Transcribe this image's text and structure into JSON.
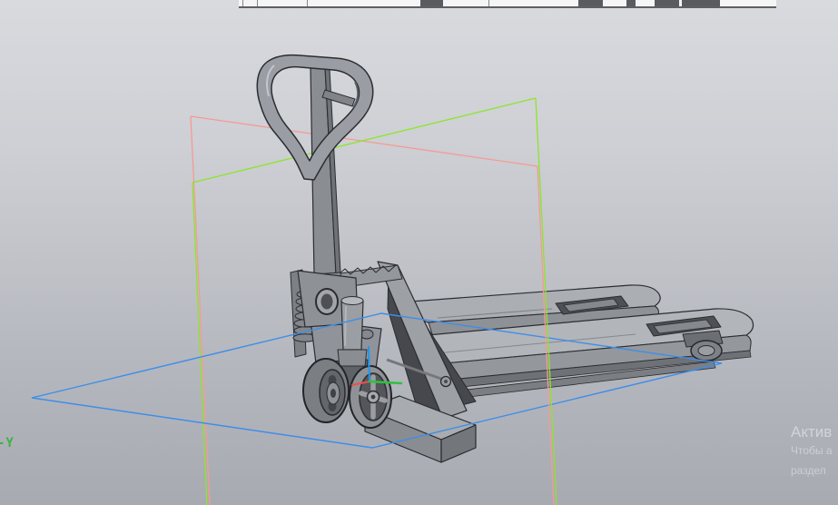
{
  "watermark": {
    "line1": "Актив",
    "line2": "Чтобы а",
    "line3": "раздел"
  },
  "axes": {
    "negative_y_label": "-Y"
  },
  "colors": {
    "plane_frontal_red": "#f59a96",
    "plane_profile_green": "#8ce62a",
    "plane_horizontal_blue": "#3e8ee8",
    "axis_x_red": "#ef4f4a",
    "axis_y_green": "#2fc13c",
    "axis_z_blue": "#1e96f0",
    "axis_label_green": "#3cb344"
  }
}
